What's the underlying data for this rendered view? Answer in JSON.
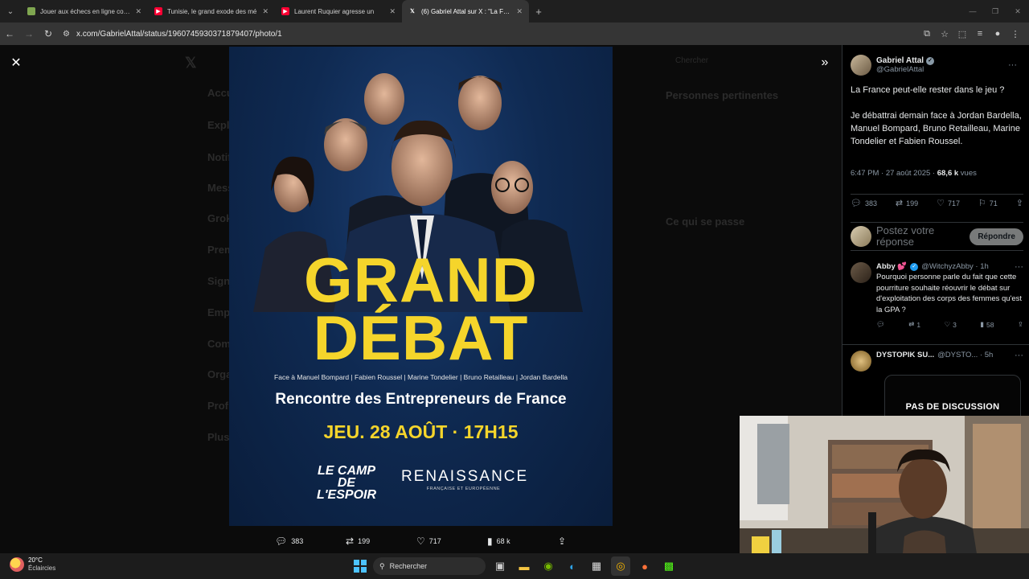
{
  "browser": {
    "tabs": [
      {
        "title": "Jouer aux échecs en ligne contre",
        "favicon_color": "#7fa650",
        "active": false
      },
      {
        "title": "Tunisie, le grand exode des mé",
        "favicon_color": "#ff0033",
        "active": false
      },
      {
        "title": "Laurent Ruquier agresse un",
        "favicon_color": "#ff0033",
        "active": false
      },
      {
        "title": "(6) Gabriel Attal sur X : \"La Franc",
        "favicon_color": "#ffffff",
        "active": true
      }
    ],
    "url": "x.com/GabrielAttal/status/1960745930371879407/photo/1"
  },
  "poster": {
    "title_line1": "GRAND",
    "title_line2": "DÉBAT",
    "faces_line": "Face à Manuel Bompard | Fabien Roussel | Marine Tondelier | Bruno Retailleau | Jordan Bardella",
    "event_name": "Rencontre des Entrepreneurs de France",
    "event_date": "JEU. 28 AOÛT · 17H15",
    "logo_camp": "LE CAMP DE L'ESPOIR",
    "logo_ren": "RENAISSANCE",
    "logo_ren_sub": "FRANÇAISE ET EUROPÉENNE",
    "accent_color": "#f5d52b"
  },
  "photo_actions": {
    "replies": "383",
    "reposts": "199",
    "likes": "717",
    "views": "68 k"
  },
  "background_ghost": {
    "search": "Chercher",
    "relevant": "Personnes pertinentes",
    "whats_happening": "Ce qui se passe",
    "nav": [
      "Accueil",
      "Explorer",
      "Notifications",
      "Messages",
      "Grok",
      "Premium",
      "Signets",
      "Emplois",
      "Communautés",
      "Organisations",
      "Profil",
      "Plus"
    ]
  },
  "tweet": {
    "author_name": "Gabriel Attal",
    "author_handle": "@GabrielAttal",
    "text_p1": "La France peut-elle rester dans le jeu ?",
    "text_p2": "Je débattrai demain face à Jordan Bardella, Manuel Bompard, Bruno Retailleau, Marine Tondelier et Fabien Roussel.",
    "time": "6:47 PM · 27 août 2025 · ",
    "views_count": "68,6 k",
    "views_label": " vues",
    "stats": {
      "replies": "383",
      "reposts": "199",
      "likes": "717",
      "bookmarks": "71"
    },
    "reply_placeholder": "Postez votre réponse",
    "reply_button": "Répondre"
  },
  "replies": [
    {
      "name": "Abby 💕",
      "handle": "@WitchyzAbby · 1h",
      "text": "Pourquoi personne parle du fait que cette pourriture souhaite réouvrir le débat sur d'exploitation des corps des femmes qu'est la GPA ?",
      "reposts": "1",
      "likes": "3",
      "views": "58"
    },
    {
      "name": "DYSTOPIK SU...",
      "handle": "@DYSTO... · 5h",
      "media_text": "PAS DE DISCUSSION"
    }
  ],
  "taskbar": {
    "temp": "20°C",
    "condition": "Éclaircies",
    "search_label": "Rechercher"
  }
}
